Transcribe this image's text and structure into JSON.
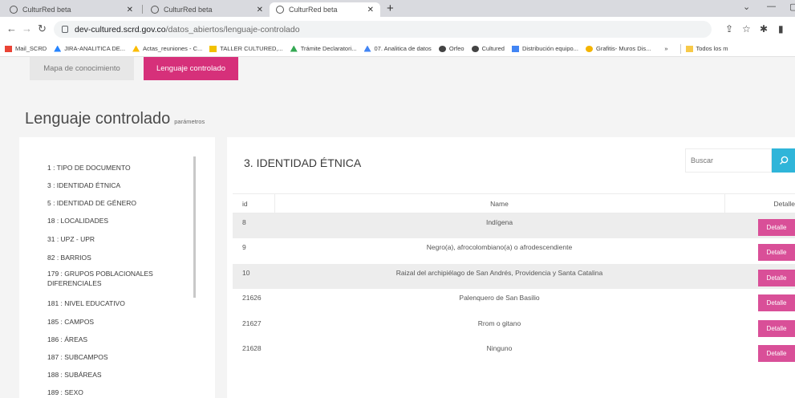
{
  "browser": {
    "tabs": [
      {
        "title": "CulturRed beta",
        "active": false
      },
      {
        "title": "CulturRed beta",
        "active": false
      },
      {
        "title": "CulturRed beta",
        "active": true
      }
    ],
    "url_host": "dev-cultured.scrd.gov.co",
    "url_path": "/datos_abiertos/lenguaje-controlado",
    "bookmarks": [
      "Mail_SCRD",
      "JIRA-ANALITICA DE...",
      "Actas_reuniones - C...",
      "TALLER CULTURED,...",
      "Trámite Declaratori...",
      "07. Analitica de datos",
      "Orfeo",
      "Cultured",
      "Distribución equipo...",
      "Grafitis- Muros Dis..."
    ],
    "bookmarks_more": "»",
    "other_bookmarks": "Todos los m"
  },
  "page": {
    "tab_mapa": "Mapa de conocimiento",
    "tab_lenguaje": "Lenguaje controlado",
    "heading": "Lenguaje controlado",
    "heading_sub": "parámetros"
  },
  "sidebar": {
    "items": [
      "1 : TIPO DE DOCUMENTO",
      "3 : IDENTIDAD ÉTNICA",
      "5 : IDENTIDAD DE GÉNERO",
      "18 : LOCALIDADES",
      "31 : UPZ - UPR",
      "82 : BARRIOS",
      "179 : GRUPOS POBLACIONALES DIFERENCIALES",
      "181 : NIVEL EDUCATIVO",
      "185 : CAMPOS",
      "186 : ÁREAS",
      "187 : SUBCAMPOS",
      "188 : SUBÁREAS",
      "189 : SEXO"
    ]
  },
  "main": {
    "title": "3. IDENTIDAD ÉTNICA",
    "search_placeholder": "Buscar",
    "columns": {
      "id": "id",
      "name": "Name",
      "detail": "Detalle"
    },
    "rows": [
      {
        "id": "8",
        "name": "Indígena",
        "detail": "Detalle"
      },
      {
        "id": "9",
        "name": "Negro(a), afrocolombiano(a) o afrodescendiente",
        "detail": "Detalle"
      },
      {
        "id": "10",
        "name": "Raizal del archipiélago de San Andrés, Providencia y Santa Catalina",
        "detail": "Detalle"
      },
      {
        "id": "21626",
        "name": "Palenquero de San Basilio",
        "detail": "Detalle"
      },
      {
        "id": "21627",
        "name": "Rrom o gitano",
        "detail": "Detalle"
      },
      {
        "id": "21628",
        "name": "Ninguno",
        "detail": "Detalle"
      }
    ]
  },
  "colors": {
    "accent": "#d6307a",
    "detail_button": "#d94f98",
    "search_button": "#2fb5d9"
  }
}
